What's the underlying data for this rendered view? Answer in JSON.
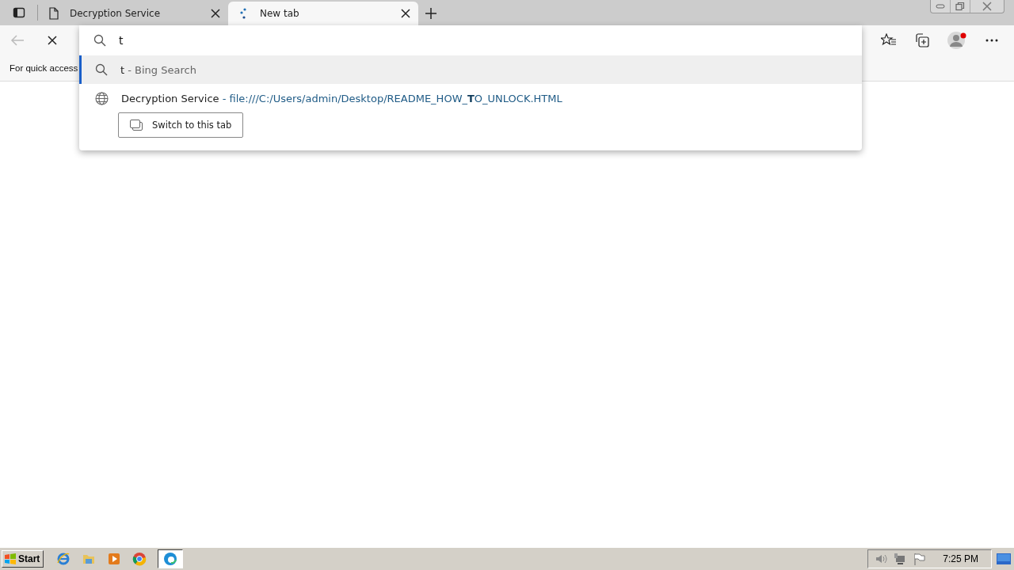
{
  "tabs": [
    {
      "title": "Decryption Service",
      "selected": false,
      "loading": false
    },
    {
      "title": "New tab",
      "selected": true,
      "loading": true
    }
  ],
  "address_bar": {
    "value": "t"
  },
  "favorites_bar": {
    "hint": "For quick access"
  },
  "suggestions": [
    {
      "kind": "search",
      "query": "t",
      "detail": "- Bing Search",
      "selected": true
    },
    {
      "kind": "page",
      "title": "Decryption Service",
      "url": "- file:///C:/Users/admin/Desktop/README_HOW_**T**O_UNLOCK.HTML",
      "action": "Switch to this tab",
      "selected": false
    }
  ],
  "taskbar": {
    "start": "Start",
    "clock": "7:25 PM"
  }
}
